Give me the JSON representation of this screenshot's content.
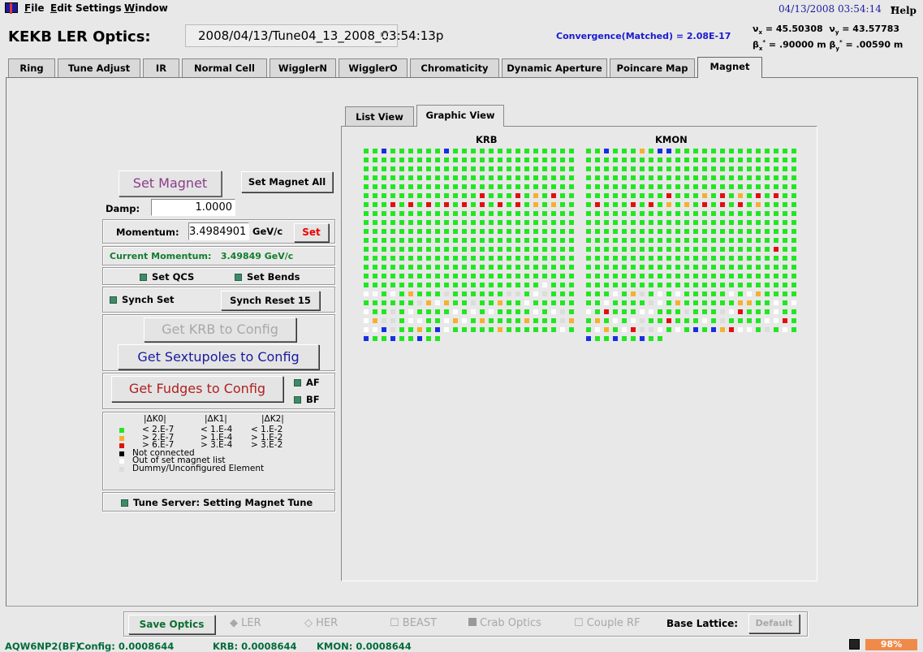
{
  "menu": {
    "items": [
      "File",
      "Edit",
      "Settings",
      "Window"
    ],
    "datetime": "04/13/2008 03:54:14",
    "help": "Help"
  },
  "header": {
    "title": "KEKB LER Optics:",
    "optics_file": "2008/04/13/Tune04_13_2008_03:54:13p",
    "convergence": "Convergence(Matched) = 2.08E-17",
    "nu_x": "= 45.50308",
    "nu_y": "= 43.57783",
    "beta_x": "= .90000 m",
    "beta_y": "= .00590 m"
  },
  "tabs": [
    "Ring",
    "Tune Adjust",
    "IR",
    "Normal Cell",
    "WigglerN",
    "WigglerO",
    "Chromaticity",
    "Dynamic Aperture",
    "Poincare Map",
    "Magnet"
  ],
  "controls": {
    "set_magnet": "Set Magnet",
    "set_magnet_all": "Set Magnet All",
    "damp_label": "Damp:",
    "damp_value": "1.0000",
    "momentum_label": "Momentum:",
    "momentum_value": "3.4984901",
    "momentum_unit": "GeV/c",
    "set": "Set",
    "current_momentum": "Current Momentum:   3.49849 GeV/c",
    "set_qcs": "Set QCS",
    "set_bends": "Set Bends",
    "synch_set": "Synch Set",
    "synch_reset": "Synch Reset 15",
    "get_krb": "Get KRB to Config",
    "get_sext": "Get Sextupoles to Config",
    "get_fudges": "Get Fudges to Config",
    "af": "AF",
    "bf": "BF",
    "tune_server": "Tune Server:  Setting Magnet Tune"
  },
  "legend": {
    "headers": [
      "|ΔK0|",
      "|ΔK1|",
      "|ΔK2|"
    ],
    "rows": [
      {
        "color": "#22e622",
        "k0": "< 2.E-7",
        "k1": "< 1.E-4",
        "k2": "< 1.E-2"
      },
      {
        "color": "#f4b030",
        "k0": "> 2.E-7",
        "k1": "> 1.E-4",
        "k2": "> 1.E-2"
      },
      {
        "color": "#e01010",
        "k0": "> 6.E-7",
        "k1": "> 3.E-4",
        "k2": "> 3.E-2"
      }
    ],
    "notes": [
      {
        "color": "#000000",
        "text": "Not connected"
      },
      {
        "color": "#ffffff",
        "text": "Out of set magnet list"
      },
      {
        "color": "#dcdcdc",
        "text": "Dummy/Unconfigured Element"
      }
    ]
  },
  "view_tabs": [
    "List View",
    "Graphic View"
  ],
  "grids": {
    "left_title": "KRB",
    "right_title": "KMON"
  },
  "bottom": {
    "save": "Save Optics",
    "ler": "LER",
    "her": "HER",
    "beast": "BEAST",
    "crab": "Crab Optics",
    "couple": "Couple RF",
    "base_lattice": "Base Lattice:",
    "default": "Default"
  },
  "status": {
    "host": "AQW6NP2(BF)",
    "config": "Config:  0.0008644",
    "krb": "KRB:  0.0008644",
    "kmon": "KMON:  0.0008644",
    "percent": "98%"
  }
}
